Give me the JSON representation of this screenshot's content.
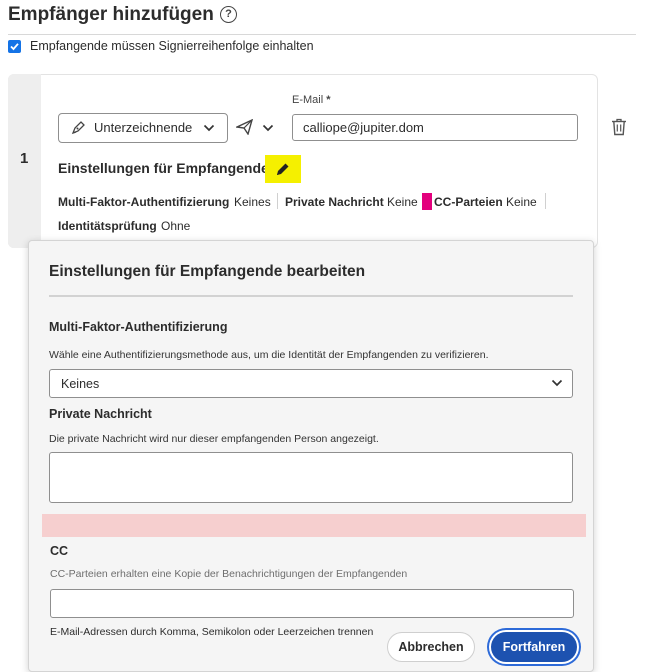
{
  "header": {
    "title": "Empfänger hinzufügen",
    "help_glyph": "?",
    "signing_order_label": "Empfangende müssen Signierreihenfolge einhalten",
    "signing_order_checked": true
  },
  "recipient": {
    "number": "1",
    "role": "Unterzeichnende",
    "email_label": "E-Mail",
    "required_marker": "*",
    "email_value": "calliope@jupiter.dom",
    "settings_title": "Einstellungen für Empfangende",
    "settings": {
      "mfa_label": "Multi-Faktor-Authentifizierung",
      "mfa_value": "Keines",
      "private_label": "Private Nachricht",
      "private_value": "Keine",
      "cc_label": "CC-Parteien",
      "cc_value": "Keine",
      "id_label": "Identitätsprüfung",
      "id_value": "Ohne"
    }
  },
  "dialog": {
    "title": "Einstellungen für Empfangende bearbeiten",
    "mfa_title": "Multi-Faktor-Authentifizierung",
    "mfa_desc": "Wähle eine Authentifizierungsmethode aus, um die Identität der Empfangenden zu verifizieren.",
    "mfa_selected": "Keines",
    "private_title": "Private Nachricht",
    "private_desc": "Die private Nachricht wird nur dieser empfangenden Person angezeigt.",
    "cc_title": "CC",
    "cc_desc": "CC-Parteien erhalten eine Kopie der Benachrichtigungen der Empfangenden",
    "cc_hint": "E-Mail-Adressen durch Komma, Semikolon oder Leerzeichen trennen",
    "cancel_label": "Abbrechen",
    "continue_label": "Fortfahren"
  },
  "colors": {
    "accent": "#1473e6",
    "primary_button": "#1d52b0",
    "highlight_yellow": "#f5f000",
    "highlight_magenta": "#e3007d",
    "highlight_pink": "#f6cfcf"
  },
  "icons": [
    "help-icon",
    "checkmark-icon",
    "signature-pen-icon",
    "chevron-down-icon",
    "send-icon",
    "trash-icon",
    "pencil-icon"
  ]
}
